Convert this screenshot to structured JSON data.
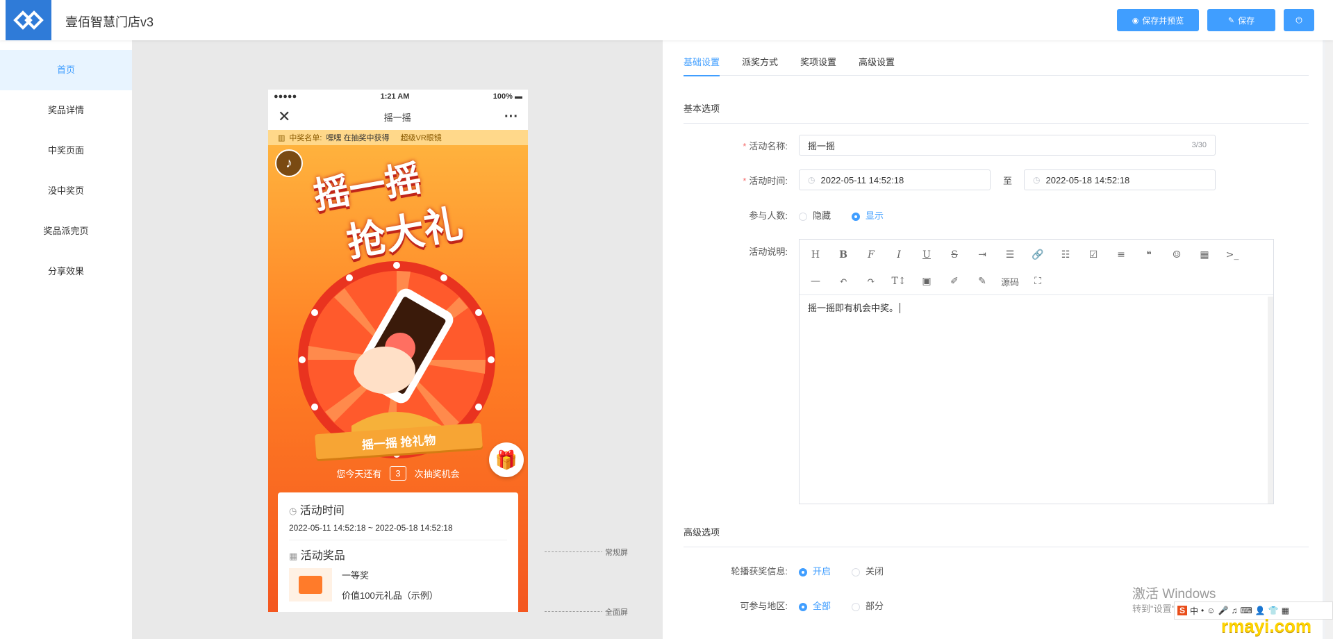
{
  "header": {
    "app_title": "壹佰智慧门店v3",
    "save_preview_label": "保存并预览",
    "save_label": "保存",
    "brand_color": "#409eff"
  },
  "sidebar": {
    "items": [
      {
        "label": "首页",
        "active": true
      },
      {
        "label": "奖品详情"
      },
      {
        "label": "中奖页面"
      },
      {
        "label": "没中奖页"
      },
      {
        "label": "奖品派完页"
      },
      {
        "label": "分享效果"
      }
    ]
  },
  "phone": {
    "status": {
      "signal": "●●●●●",
      "time": "1:21 AM",
      "battery": "100%"
    },
    "nav_title": "摇一摇",
    "ticker": {
      "prefix": "中奖名单:",
      "winner": "嘿嘿 在抽奖中获得",
      "prize": "超级VR眼镜"
    },
    "headline_line1": "摇一摇",
    "headline_line2": "抢大礼",
    "ribbon": "摇一摇 抢礼物",
    "chance_prefix": "您今天还有",
    "chance_count": "3",
    "chance_suffix": "次抽奖机会",
    "time_title": "活动时间",
    "time_value": "2022-05-11 14:52:18 ~ 2022-05-18 14:52:18",
    "prize_title": "活动奖品",
    "prize_name": "一等奖",
    "prize_desc": "价值100元礼品（示例）"
  },
  "markers": {
    "normal": "常规屏",
    "full": "全面屏"
  },
  "config": {
    "tabs": [
      {
        "label": "基础设置",
        "active": true
      },
      {
        "label": "派奖方式"
      },
      {
        "label": "奖项设置"
      },
      {
        "label": "高级设置"
      }
    ],
    "basic_section": "基本选项",
    "name_label": "活动名称:",
    "name_value": "摇一摇",
    "name_count": "3/30",
    "time_label": "活动时间:",
    "start_time": "2022-05-11 14:52:18",
    "to_label": "至",
    "end_time": "2022-05-18 14:52:18",
    "participants_label": "参与人数:",
    "participants_options": [
      "隐藏",
      "显示"
    ],
    "desc_label": "活动说明:",
    "source_label": "源码",
    "desc_value": "摇一摇即有机会中奖。",
    "advanced_section": "高级选项",
    "carousel_label": "轮播获奖信息:",
    "carousel_options": [
      "开启",
      "关闭"
    ],
    "region_label": "可参与地区:",
    "region_options": [
      "全部",
      "部分"
    ]
  },
  "overlay": {
    "watermark_title": "激活 Windows",
    "watermark_sub": "转到\"设置\"以激活 Windows。",
    "site_mark": "rmayi.com"
  }
}
